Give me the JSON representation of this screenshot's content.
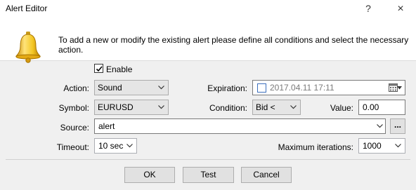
{
  "window": {
    "title": "Alert Editor",
    "help_glyph": "?",
    "close_glyph": "×"
  },
  "header": {
    "info_text": "To add a new or modify the existing alert please define all conditions and select the necessary action.",
    "icon": "bell-icon"
  },
  "form": {
    "enable": {
      "label": "Enable",
      "checked": true
    },
    "action": {
      "label": "Action:",
      "value": "Sound"
    },
    "expiration": {
      "label": "Expiration:",
      "value": "2017.04.11 17:11",
      "checked": false
    },
    "symbol": {
      "label": "Symbol:",
      "value": "EURUSD"
    },
    "condition": {
      "label": "Condition:",
      "value": "Bid <"
    },
    "value": {
      "label": "Value:",
      "value": "0.00"
    },
    "source": {
      "label": "Source:",
      "value": "alert",
      "browse_label": "..."
    },
    "timeout": {
      "label": "Timeout:",
      "value": "10 sec"
    },
    "max_iterations": {
      "label": "Maximum iterations:",
      "value": "1000"
    }
  },
  "buttons": {
    "ok": "OK",
    "test": "Test",
    "cancel": "Cancel"
  },
  "colors": {
    "background": "#f0f0f0",
    "header_background": "#ffffff",
    "bell": "#f3c623",
    "checkbox_accent": "#3c6fbd"
  }
}
